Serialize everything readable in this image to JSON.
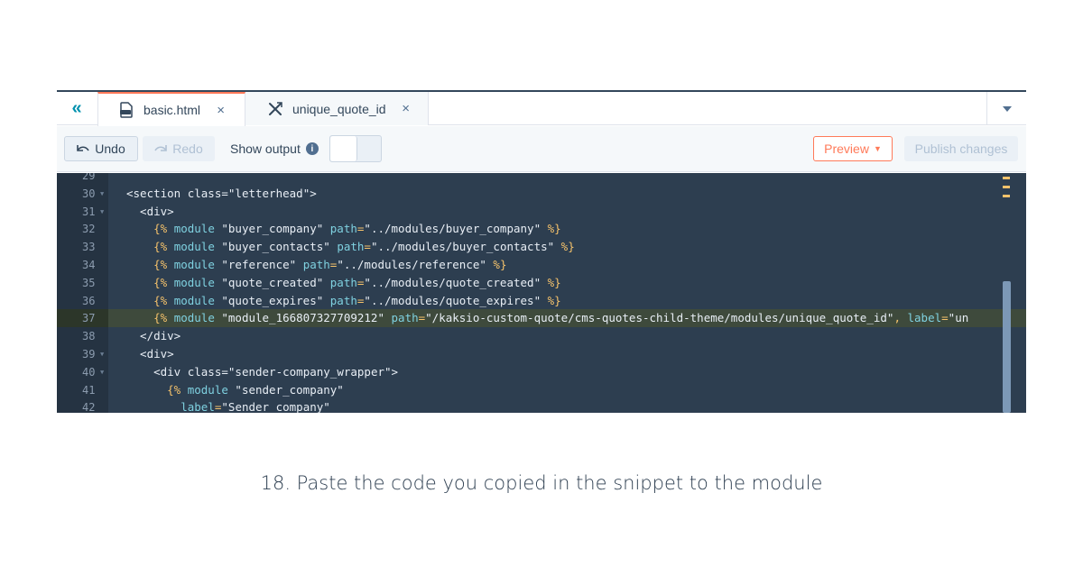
{
  "tabs": {
    "collapse_icon": "double-chevron-left-icon",
    "active": {
      "label": "basic.html",
      "icon": "html-file-icon",
      "close": "×"
    },
    "inactive": {
      "label": "unique_quote_id",
      "icon": "tools-icon",
      "close": "×"
    },
    "dropdown_icon": "caret-down-icon"
  },
  "toolbar": {
    "undo_label": "Undo",
    "redo_label": "Redo",
    "show_output_label": "Show output",
    "info_icon": "i",
    "preview_label": "Preview",
    "publish_label": "Publish changes"
  },
  "editor": {
    "lines": [
      {
        "num": "29",
        "fold": "",
        "tokens": []
      },
      {
        "num": "30",
        "fold": "▼",
        "tokens": [
          {
            "t": "<section ",
            "c": "tag"
          },
          {
            "t": "class",
            "c": "attr"
          },
          {
            "t": "=",
            "c": "tag"
          },
          {
            "t": "\"letterhead\"",
            "c": "str"
          },
          {
            "t": ">",
            "c": "tag"
          }
        ]
      },
      {
        "num": "31",
        "fold": "▼",
        "tokens": [
          {
            "t": "  <div>",
            "c": "tag"
          }
        ]
      },
      {
        "num": "32",
        "fold": "",
        "tokens": [
          {
            "t": "    {% ",
            "c": "tmpl"
          },
          {
            "t": "module",
            "c": "kw"
          },
          {
            "t": " \"buyer_company\" ",
            "c": "str"
          },
          {
            "t": "path",
            "c": "kw"
          },
          {
            "t": "=",
            "c": "tmpl"
          },
          {
            "t": "\"../modules/buyer_company\"",
            "c": "str"
          },
          {
            "t": " %}",
            "c": "tmpl"
          }
        ]
      },
      {
        "num": "33",
        "fold": "",
        "tokens": [
          {
            "t": "    {% ",
            "c": "tmpl"
          },
          {
            "t": "module",
            "c": "kw"
          },
          {
            "t": " \"buyer_contacts\" ",
            "c": "str"
          },
          {
            "t": "path",
            "c": "kw"
          },
          {
            "t": "=",
            "c": "tmpl"
          },
          {
            "t": "\"../modules/buyer_contacts\"",
            "c": "str"
          },
          {
            "t": " %}",
            "c": "tmpl"
          }
        ]
      },
      {
        "num": "34",
        "fold": "",
        "tokens": [
          {
            "t": "    {% ",
            "c": "tmpl"
          },
          {
            "t": "module",
            "c": "kw"
          },
          {
            "t": " \"reference\" ",
            "c": "str"
          },
          {
            "t": "path",
            "c": "kw"
          },
          {
            "t": "=",
            "c": "tmpl"
          },
          {
            "t": "\"../modules/reference\"",
            "c": "str"
          },
          {
            "t": " %}",
            "c": "tmpl"
          }
        ]
      },
      {
        "num": "35",
        "fold": "",
        "tokens": [
          {
            "t": "    {% ",
            "c": "tmpl"
          },
          {
            "t": "module",
            "c": "kw"
          },
          {
            "t": " \"quote_created\" ",
            "c": "str"
          },
          {
            "t": "path",
            "c": "kw"
          },
          {
            "t": "=",
            "c": "tmpl"
          },
          {
            "t": "\"../modules/quote_created\"",
            "c": "str"
          },
          {
            "t": " %}",
            "c": "tmpl"
          }
        ]
      },
      {
        "num": "36",
        "fold": "",
        "tokens": [
          {
            "t": "    {% ",
            "c": "tmpl"
          },
          {
            "t": "module",
            "c": "kw"
          },
          {
            "t": " \"quote_expires\" ",
            "c": "str"
          },
          {
            "t": "path",
            "c": "kw"
          },
          {
            "t": "=",
            "c": "tmpl"
          },
          {
            "t": "\"../modules/quote_expires\"",
            "c": "str"
          },
          {
            "t": " %}",
            "c": "tmpl"
          }
        ]
      },
      {
        "num": "37",
        "fold": "",
        "highlight": true,
        "tokens": [
          {
            "t": "    {% ",
            "c": "tmpl"
          },
          {
            "t": "module",
            "c": "kw"
          },
          {
            "t": " \"module_166807327709212\" ",
            "c": "str"
          },
          {
            "t": "path",
            "c": "kw"
          },
          {
            "t": "=",
            "c": "tmpl"
          },
          {
            "t": "\"/kaksio-custom-quote/cms-quotes-child-theme/modules/unique_quote_id\"",
            "c": "str"
          },
          {
            "t": ", ",
            "c": "tmpl"
          },
          {
            "t": "label",
            "c": "kw"
          },
          {
            "t": "=",
            "c": "tmpl"
          },
          {
            "t": "\"un",
            "c": "str"
          }
        ]
      },
      {
        "num": "38",
        "fold": "",
        "tokens": [
          {
            "t": "  </div>",
            "c": "tag"
          }
        ]
      },
      {
        "num": "39",
        "fold": "▼",
        "tokens": [
          {
            "t": "  <div>",
            "c": "tag"
          }
        ]
      },
      {
        "num": "40",
        "fold": "▼",
        "tokens": [
          {
            "t": "    <div ",
            "c": "tag"
          },
          {
            "t": "class",
            "c": "attr"
          },
          {
            "t": "=",
            "c": "tag"
          },
          {
            "t": "\"sender-company_wrapper\"",
            "c": "str"
          },
          {
            "t": ">",
            "c": "tag"
          }
        ]
      },
      {
        "num": "41",
        "fold": "",
        "tokens": [
          {
            "t": "      {% ",
            "c": "tmpl"
          },
          {
            "t": "module",
            "c": "kw"
          },
          {
            "t": " \"sender_company\"",
            "c": "str"
          }
        ]
      },
      {
        "num": "42",
        "fold": "",
        "tokens": [
          {
            "t": "        ",
            "c": "tmpl"
          },
          {
            "t": "label",
            "c": "kw"
          },
          {
            "t": "=",
            "c": "tmpl"
          },
          {
            "t": "\"Sender company\"",
            "c": "str"
          }
        ]
      }
    ],
    "colors": {
      "tag": "#e8eef5",
      "attr": "#e8eef5",
      "str": "#e8eef5",
      "kw": "#7fd1e0",
      "tmpl": "#f5c26b"
    }
  },
  "caption": "18. Paste the code you copied in the snippet to the module"
}
